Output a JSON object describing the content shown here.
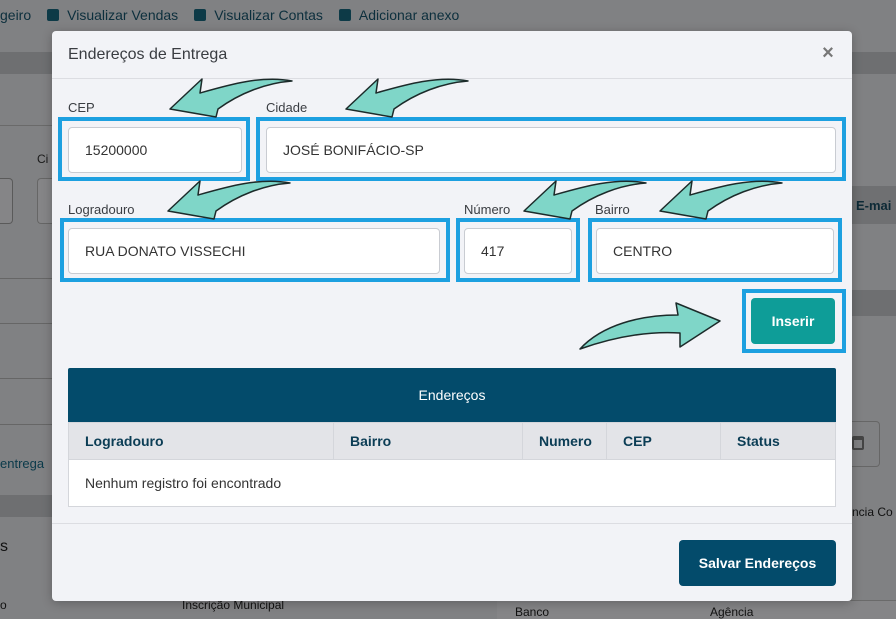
{
  "background": {
    "toolbar": [
      {
        "label": "geiro"
      },
      {
        "label": "Visualizar Vendas",
        "icon": "gear-icon"
      },
      {
        "label": "Visualizar Contas",
        "icon": "document-icon"
      },
      {
        "label": "Adicionar anexo",
        "icon": "plus-square-icon"
      }
    ],
    "ci_label": "Ci",
    "entrega_text": "entrega",
    "s_text": "s",
    "o_text": "o",
    "inscricao_text": "Inscrição Municipal",
    "email_tab": "E-mai",
    "ncia_text": "ncia Co",
    "banco_label": "Banco",
    "agencia_label": "Agência"
  },
  "modal": {
    "title": "Endereços de Entrega",
    "close_icon": "×",
    "fields": {
      "cep": {
        "label": "CEP",
        "value": "15200000"
      },
      "cidade": {
        "label": "Cidade",
        "value": "JOSÉ BONIFÁCIO-SP"
      },
      "logradouro": {
        "label": "Logradouro",
        "value": "RUA DONATO VISSECHI"
      },
      "numero": {
        "label": "Número",
        "value": "417"
      },
      "bairro": {
        "label": "Bairro",
        "value": "CENTRO"
      }
    },
    "insert_button": "Inserir",
    "table": {
      "title": "Endereços",
      "columns": [
        "Logradouro",
        "Bairro",
        "Numero",
        "CEP",
        "Status"
      ],
      "empty_message": "Nenhum registro foi encontrado"
    },
    "save_button": "Salvar Endereços"
  },
  "colors": {
    "highlight": "#1da0e0",
    "arrow_fill": "#7fd6c8",
    "primary": "#034b6b",
    "teal_button": "#0e9d98"
  }
}
